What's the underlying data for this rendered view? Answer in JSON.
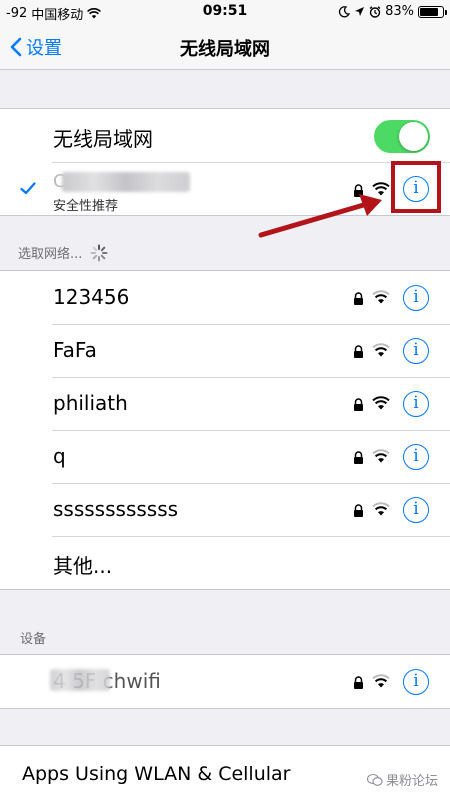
{
  "status_bar": {
    "signal": "-92",
    "carrier": "中国移动",
    "time": "09:51",
    "battery": "83%",
    "battery_level": 0.83,
    "icons": [
      "wifi-icon",
      "moon-icon",
      "location-icon",
      "alarm-icon",
      "battery-icon"
    ]
  },
  "nav": {
    "back_label": "设置",
    "title": "无线局域网"
  },
  "wlan_toggle": {
    "label": "无线局域网",
    "on": true,
    "accent": "#4cd964"
  },
  "connected": {
    "name": "C",
    "subtitle": "安全性推荐"
  },
  "choose_section": {
    "header": "选取网络..."
  },
  "networks": [
    {
      "name": "123456"
    },
    {
      "name": "FaFa"
    },
    {
      "name": "philiath"
    },
    {
      "name": "q"
    },
    {
      "name": "ssssssssssss"
    }
  ],
  "other": "其他...",
  "devices_section": {
    "header": "设备",
    "device_name": "4 5F  chwifi"
  },
  "bottom": {
    "label": "Apps Using WLAN & Cellular",
    "watermark": "果粉论坛"
  },
  "colors": {
    "link": "#007aff",
    "annotation": "#b3141a"
  }
}
